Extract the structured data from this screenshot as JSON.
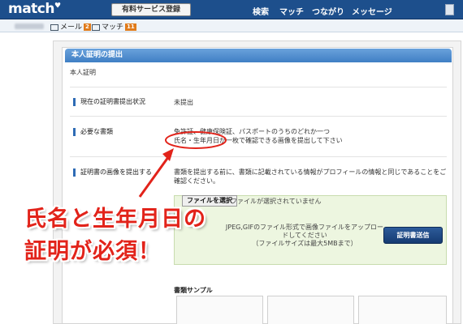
{
  "topbar": {
    "logo": "match",
    "upgrade_button": "有料サービス登録",
    "nav": [
      "検索",
      "マッチ",
      "つながり",
      "メッセージ"
    ]
  },
  "subbar": {
    "mail_label": "メール",
    "mail_count": "2",
    "match_label": "マッチ",
    "match_count": "11"
  },
  "section": {
    "header": "本人証明の提出",
    "subtitle": "本人証明"
  },
  "rows": {
    "status_label": "現在の証明書提出状況",
    "status_value": "未提出",
    "docs_label": "必要な書類",
    "docs_line1": "免許証、健康保険証、パスポートのうちのどれか一つ",
    "docs_line2": "氏名・生年月日が一枚で確認できる画像を提出して下さい",
    "upload_label": "証明書の画像を提出する",
    "upload_note": "書類を提出する前に、書類に記載されている情報がプロフィールの情報と同じであることをご確認ください。"
  },
  "upload": {
    "file_button": "ファイルを選択",
    "file_status": "ファイルが選択されていません",
    "instructions": "JPEG,GIFのファイル形式で画像ファイルをアップロードしてください",
    "size_limit": "（ファイルサイズは最大5MBまで）",
    "submit_button": "証明書送信"
  },
  "samples": {
    "title": "書類サンプル"
  },
  "annotation": {
    "line1": "氏名と生年月日の",
    "line2": "証明が必須！"
  },
  "colors": {
    "nav_blue": "#1d4f8c",
    "header_blue": "#3f7fc4",
    "badge_orange": "#e07b1a",
    "annotation_red": "#e2231a"
  }
}
